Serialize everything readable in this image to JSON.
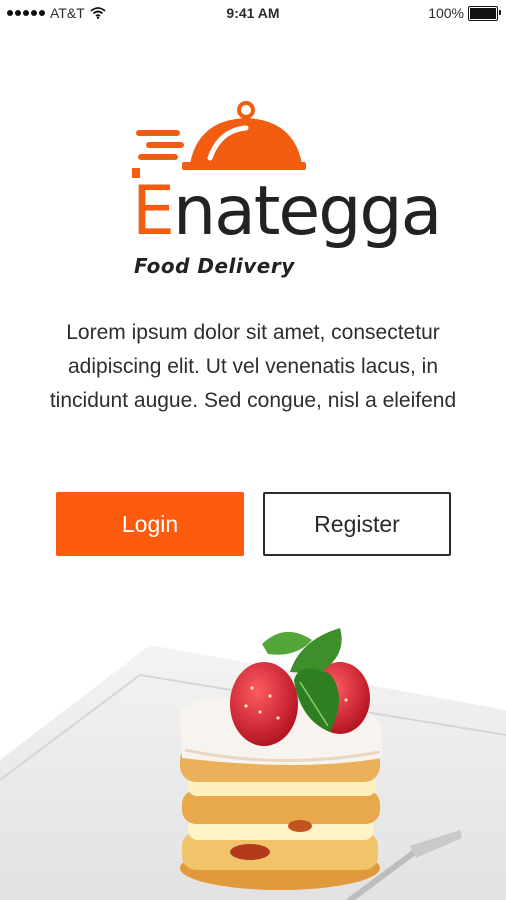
{
  "status_bar": {
    "carrier": "AT&T",
    "time": "9:41 AM",
    "battery": "100%",
    "battery_level": 1.0
  },
  "logo": {
    "first_letter": "E",
    "rest": "nategga",
    "tagline": "Food Delivery",
    "accent_color": "#f35d12"
  },
  "description": "Lorem ipsum dolor sit amet, consectetur adipiscing elit. Ut vel venenatis lacus, in tincidunt augue. Sed congue, nisl a eleifend",
  "buttons": {
    "login_label": "Login",
    "register_label": "Register",
    "login_color": "#fc5b0d"
  },
  "icons": [
    "wifi-icon",
    "battery-icon",
    "cloche-icon"
  ]
}
